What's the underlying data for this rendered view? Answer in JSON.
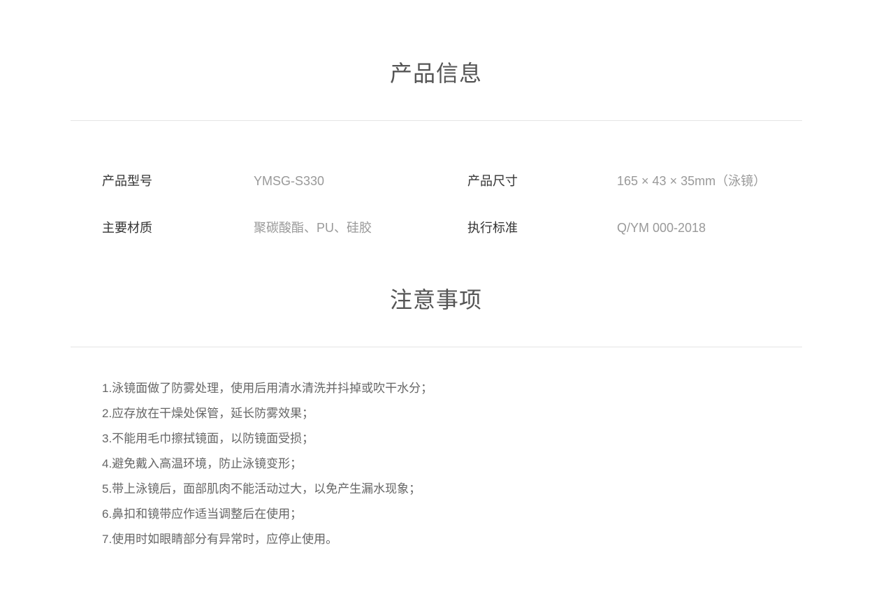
{
  "product_info": {
    "title": "产品信息",
    "rows": [
      [
        {
          "label": "产品型号",
          "value": "YMSG-S330"
        },
        {
          "label": "产品尺寸",
          "value": "165 × 43 × 35mm（泳镜）"
        }
      ],
      [
        {
          "label": "主要材质",
          "value": "聚碳酸酯、PU、硅胶"
        },
        {
          "label": "执行标准",
          "value": "Q/YM 000-2018"
        }
      ]
    ]
  },
  "notes": {
    "title": "注意事项",
    "items": [
      "1.泳镜面做了防雾处理，使用后用清水清洗并抖掉或吹干水分；",
      "2.应存放在干燥处保管，延长防雾效果；",
      "3.不能用毛巾擦拭镜面，以防镜面受损；",
      "4.避免戴入高温环境，防止泳镜变形；",
      "5.带上泳镜后，面部肌肉不能活动过大，以免产生漏水现象；",
      "6.鼻扣和镜带应作适当调整后在使用；",
      "7.使用时如眼睛部分有异常时，应停止使用。"
    ]
  },
  "colors": {
    "title": "#555555",
    "label": "#333333",
    "value": "#999999",
    "note": "#666666",
    "divider": "#e5e5e5"
  }
}
